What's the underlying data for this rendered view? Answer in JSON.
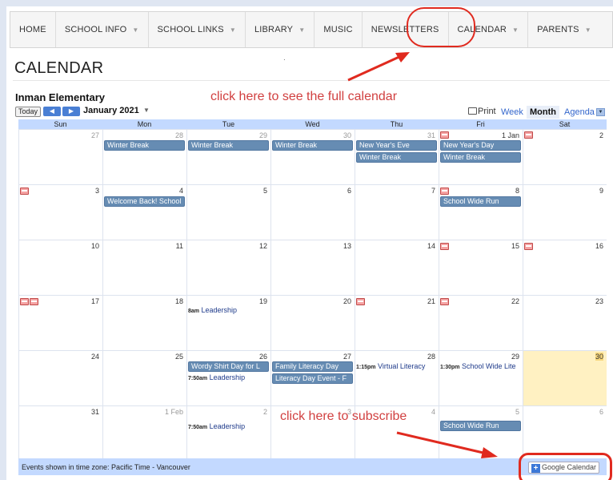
{
  "nav": {
    "home": "HOME",
    "school_info": "SCHOOL INFO",
    "school_links": "SCHOOL LINKS",
    "library": "LIBRARY",
    "music": "MUSIC",
    "newsletters": "NEWSLETTERS",
    "calendar": "CALENDAR",
    "parents": "PARENTS"
  },
  "page_title": "CALENDAR",
  "calendar_name": "Inman Elementary",
  "annotations": {
    "full_calendar": "click here to see the full calendar",
    "subscribe": "click here to subscribe"
  },
  "toolbar": {
    "today": "Today",
    "prev_icon": "chevron-left-icon",
    "next_icon": "chevron-right-icon",
    "month_label": "January 2021",
    "print": "Print",
    "view_week": "Week",
    "view_month": "Month",
    "view_agenda": "Agenda"
  },
  "days_of_week": [
    "Sun",
    "Mon",
    "Tue",
    "Wed",
    "Thu",
    "Fri",
    "Sat"
  ],
  "weeks": [
    [
      "27",
      "28",
      "29",
      "30",
      "31",
      "1 Jan",
      "2"
    ],
    [
      "3",
      "4",
      "5",
      "6",
      "7",
      "8",
      "9"
    ],
    [
      "10",
      "11",
      "12",
      "13",
      "14",
      "15",
      "16"
    ],
    [
      "17",
      "18",
      "19",
      "20",
      "21",
      "22",
      "23"
    ],
    [
      "24",
      "25",
      "26",
      "27",
      "28",
      "29",
      "30"
    ],
    [
      "31",
      "1 Feb",
      "2",
      "3",
      "4",
      "5",
      "6"
    ]
  ],
  "events": {
    "winter_break": "Winter Break",
    "new_years_eve": "New Year's Eve",
    "new_years_day": "New Year's Day",
    "welcome_back": "Welcome Back! School",
    "school_wide_run": "School Wide Run",
    "leadership_8am_time": "8am",
    "leadership_750_time": "7:50am",
    "leadership": "Leadership",
    "wordy_shirt": "Wordy Shirt Day for L",
    "family_literacy": "Family Literacy Day",
    "literacy_event": "Literacy Day Event - F",
    "virtual_literacy_time": "1:15pm",
    "virtual_literacy": "Virtual Literacy",
    "school_wide_lite_time": "1:30pm",
    "school_wide_lite": "School Wide Lite"
  },
  "footer": {
    "timezone": "Events shown in time zone: Pacific Time - Vancouver",
    "gcal_button": "Google Calendar",
    "gcal_plus": "+"
  },
  "colors": {
    "event_bar": "#668cb3",
    "calendar_frame": "#c3d9ff",
    "today_highlight": "#fff1c2",
    "annotation_red": "#e02a1f"
  }
}
